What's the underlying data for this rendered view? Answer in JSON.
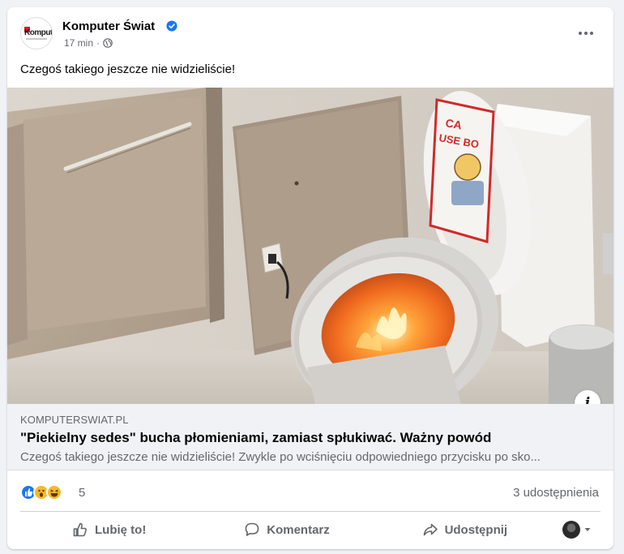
{
  "post": {
    "page_name": "Komputer Świat",
    "logo_text": "Komputer",
    "time": "17 min",
    "separator": "·",
    "text": "Czegoś takiego jeszcze nie widzieliście!"
  },
  "link": {
    "domain": "KOMPUTERSWIAT.PL",
    "title": "\"Piekielny sedes\" bucha płomieniami, zamiast spłukiwać. Ważny powód",
    "description": "Czegoś takiego jeszcze nie widzieliście! Zwykle po wciśnięciu odpowiedniego przycisku po sko..."
  },
  "image": {
    "sign_line1": "CA",
    "sign_line2": "USE BO"
  },
  "stats": {
    "reaction_count": "5",
    "shares": "3 udostępnienia",
    "reactions": [
      "like-icon",
      "wow-icon",
      "haha-icon"
    ]
  },
  "actions": {
    "like": "Lubię to!",
    "comment": "Komentarz",
    "share": "Udostępnij"
  },
  "info_label": "i",
  "colors": {
    "accent": "#1877f2",
    "secondary_text": "#65676b",
    "link_bg": "#f0f2f5"
  }
}
